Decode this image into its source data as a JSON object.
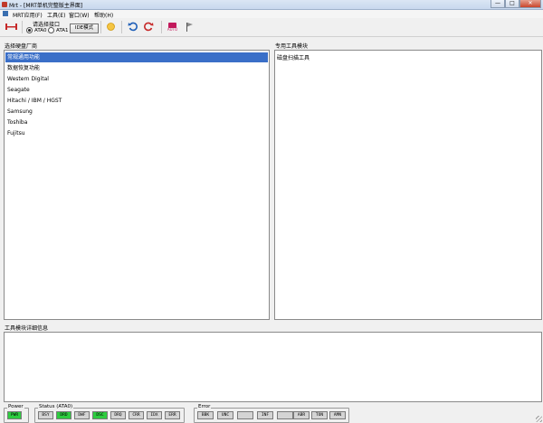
{
  "window": {
    "title": "Mrt - [MRT单机完整版主界面]",
    "minimize": "—",
    "maximize": "□",
    "close": "✕"
  },
  "menu": [
    "MRT应用(F)",
    "工具(E)",
    "窗口(W)",
    "帮助(H)"
  ],
  "toolbar": {
    "port_title": "请选择接口",
    "ports": [
      {
        "label": "ATA0",
        "selected": true
      },
      {
        "label": "ATA1",
        "selected": false
      }
    ],
    "ide_button": "IDE模式",
    "auto_label": "AUTO",
    "icons": [
      "connect-icon",
      "sun-icon",
      "undo-icon",
      "redo-icon",
      "auto-icon",
      "flag-icon"
    ]
  },
  "left_panel": {
    "title": "选择硬盘厂商",
    "items": [
      "常规通用功能",
      "数据恢复功能",
      "Western Digital",
      "Seagate",
      "Hitachi / IBM / HGST",
      "Samsung",
      "Toshiba",
      "Fujitsu"
    ],
    "selected_index": 0
  },
  "right_panel": {
    "title": "专用工具模块",
    "items": [
      "磁盘扫描工具"
    ]
  },
  "log_panel": {
    "title": "工具模块详细信息"
  },
  "status": {
    "power": {
      "title": "Power",
      "leds": [
        {
          "label": "PWR",
          "on": true
        }
      ]
    },
    "status": {
      "title": "Status (ATA0)",
      "leds": [
        {
          "label": "BSY",
          "on": false
        },
        {
          "label": "DRD",
          "on": true
        },
        {
          "label": "DWF",
          "on": false
        },
        {
          "label": "DSC",
          "on": true
        },
        {
          "label": "DRQ",
          "on": false
        },
        {
          "label": "CRR",
          "on": false
        },
        {
          "label": "IDX",
          "on": false
        },
        {
          "label": "ERR",
          "on": false
        }
      ]
    },
    "error": {
      "title": "Error",
      "leds": [
        {
          "label": "BBK",
          "on": false
        },
        {
          "label": "UNC",
          "on": false
        },
        {
          "label": "",
          "on": false
        },
        {
          "label": "INF",
          "on": false
        },
        {
          "label": "",
          "on": false
        },
        {
          "label": "ABR",
          "on": false
        },
        {
          "label": "TON",
          "on": false
        },
        {
          "label": "AMN",
          "on": false
        }
      ]
    }
  },
  "colors": {
    "selection": "#3a6fc8",
    "led_on": "#2ecc40",
    "led_off": "#d4d4d4"
  }
}
